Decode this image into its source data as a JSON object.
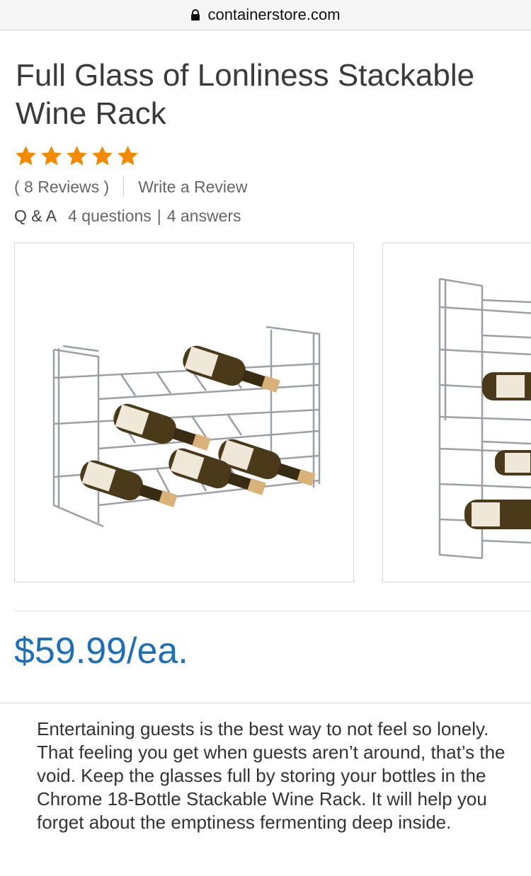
{
  "browser": {
    "url": "containerstore.com"
  },
  "product": {
    "title": "Full Glass of Lonliness Stackable Wine Rack",
    "rating": 5,
    "rating_max": 5,
    "reviews_label": "( 8 Reviews )",
    "write_review_label": "Write a Review",
    "qa_label": "Q & A",
    "questions_label": "4 questions",
    "answers_label": "4 answers",
    "price": "$59.99/ea.",
    "description": "Entertaining guests is the best way to not feel so lonely. That feeling you get when guests aren’t around, that’s the void. Keep the glasses full by storing your bottles in the Chrome 18-Bottle Stackable Wine Rack. It will help you forget about the emptiness fermenting deep inside."
  },
  "colors": {
    "star": "#f28a00",
    "price": "#1d6fb8",
    "text": "#333333"
  },
  "icons": [
    "lock-icon",
    "star-icon"
  ]
}
